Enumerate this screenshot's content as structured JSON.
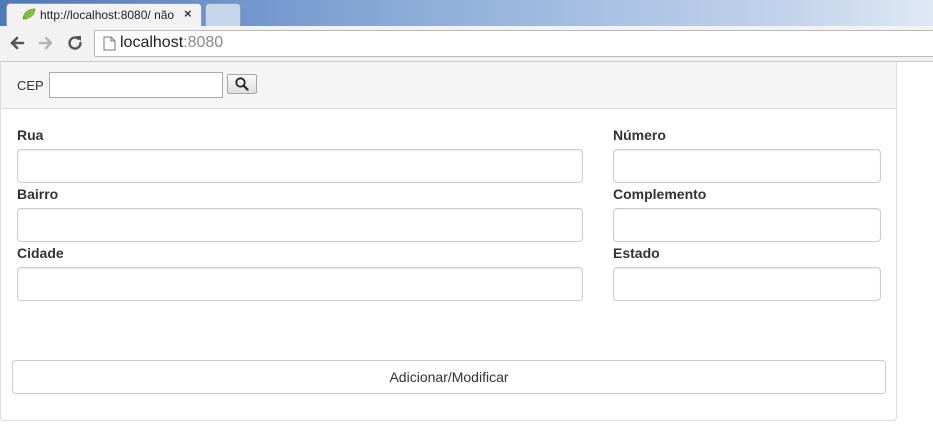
{
  "browser": {
    "active_tab_title": "http://localhost:8080/ não",
    "url_host": "localhost",
    "url_port": ":8080"
  },
  "form": {
    "cep_label": "CEP",
    "cep_value": "",
    "fields": {
      "rua": {
        "label": "Rua",
        "value": ""
      },
      "numero": {
        "label": "Número",
        "value": ""
      },
      "bairro": {
        "label": "Bairro",
        "value": ""
      },
      "complemento": {
        "label": "Complemento",
        "value": ""
      },
      "cidade": {
        "label": "Cidade",
        "value": ""
      },
      "estado": {
        "label": "Estado",
        "value": ""
      }
    },
    "submit_label": "Adicionar/Modificar"
  },
  "icons": {
    "favicon": "leaf-icon",
    "search": "search-icon",
    "back": "back-arrow-icon",
    "forward": "forward-arrow-icon",
    "reload": "reload-icon",
    "page": "page-icon",
    "close": "close-icon"
  },
  "colors": {
    "panel_heading_bg": "#f5f5f5",
    "border": "#dddddd",
    "input_border": "#cccccc"
  }
}
